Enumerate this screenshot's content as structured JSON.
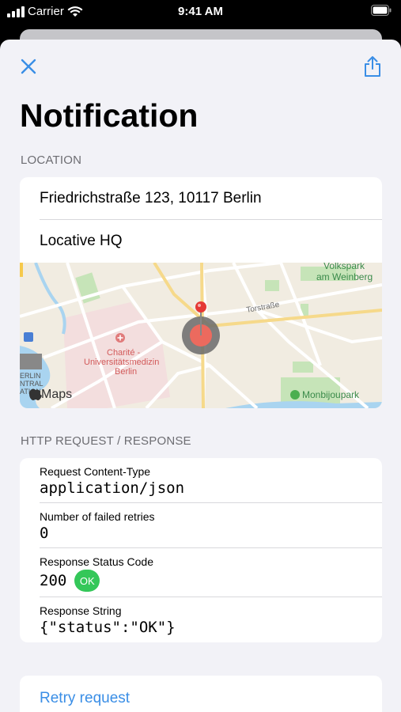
{
  "status_bar": {
    "carrier": "Carrier",
    "time": "9:41 AM"
  },
  "nav": {
    "close_icon": "close-icon",
    "share_icon": "share-icon"
  },
  "title": "Notification",
  "location": {
    "header": "LOCATION",
    "address": "Friedrichstraße 123, 10117 Berlin",
    "name": "Locative HQ",
    "map": {
      "attribution": "Maps",
      "labels": {
        "volkspark_1": "Volkspark",
        "volkspark_2": "am Weinberg",
        "torstrasse": "Torstraße",
        "charite_1": "Charité -",
        "charite_2": "Universitätsmedizin",
        "charite_3": "Berlin",
        "monbijou": "Monbijoupark",
        "berlin_1": "ERLIN",
        "berlin_2": "NTRAL",
        "berlin_3": "ATION"
      }
    }
  },
  "http": {
    "header": "HTTP REQUEST / RESPONSE",
    "rows": [
      {
        "label": "Request Content-Type",
        "value": "application/json"
      },
      {
        "label": "Number of failed retries",
        "value": "0"
      },
      {
        "label": "Response Status Code",
        "value": "200",
        "badge": "OK"
      },
      {
        "label": "Response String",
        "value": "{\"status\":\"OK\"}"
      }
    ]
  },
  "retry_label": "Retry request",
  "colors": {
    "accent": "#3a8ee6",
    "ok_badge": "#34c759",
    "pin": "#e53935"
  }
}
